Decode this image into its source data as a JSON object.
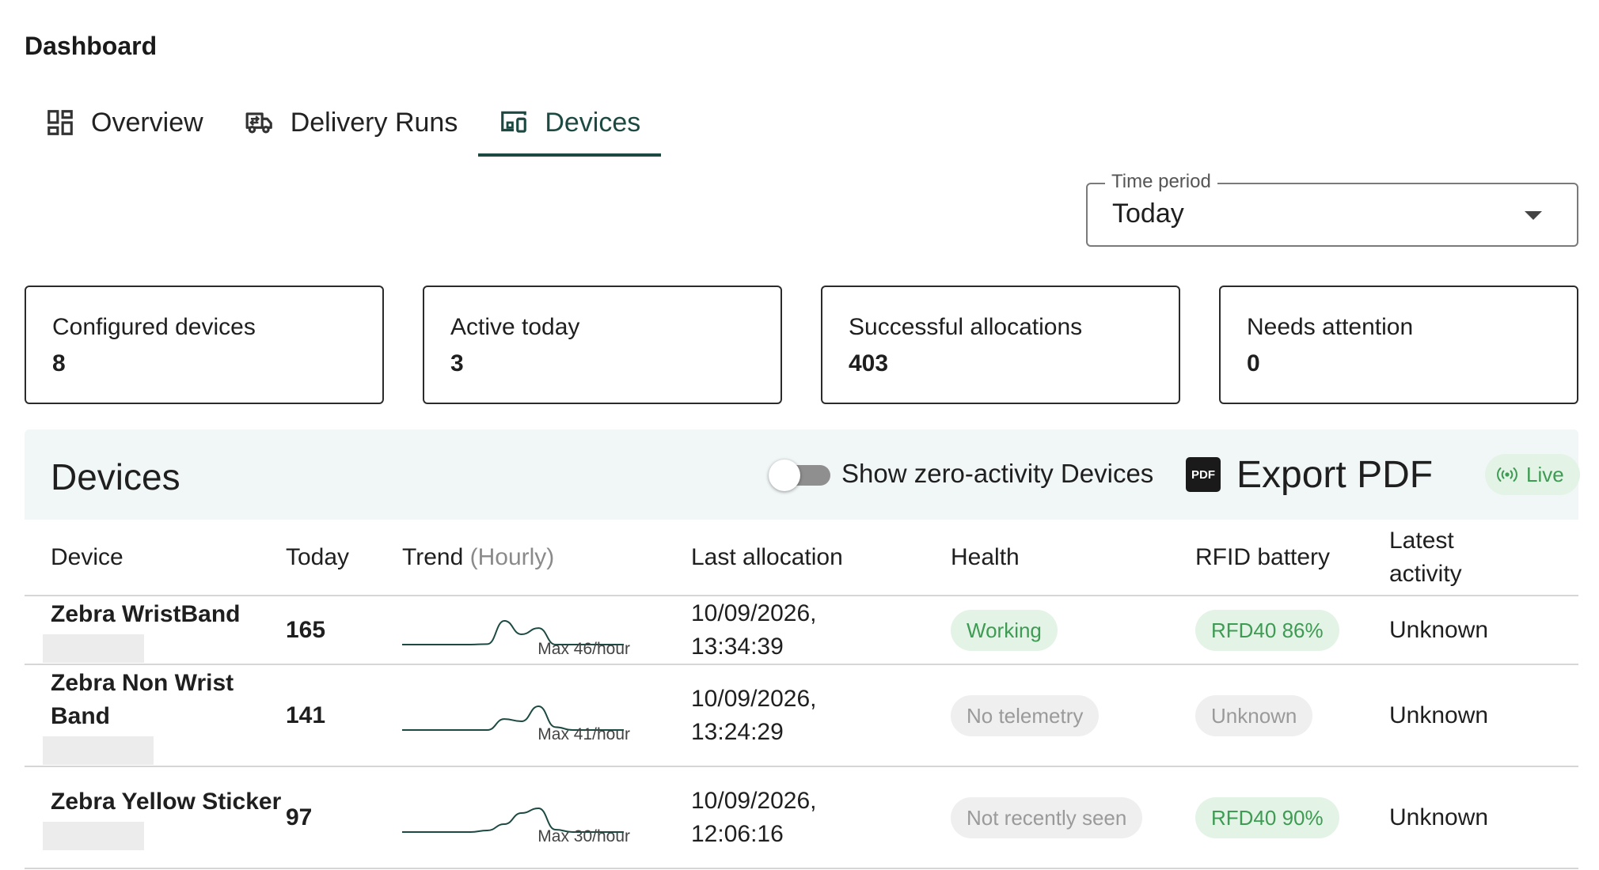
{
  "page": {
    "title": "Dashboard"
  },
  "tabs": [
    {
      "label": "Overview",
      "icon": "dashboard-icon",
      "active": false
    },
    {
      "label": "Delivery Runs",
      "icon": "truck-icon",
      "active": false
    },
    {
      "label": "Devices",
      "icon": "devices-icon",
      "active": true
    }
  ],
  "time_period": {
    "label": "Time period",
    "value": "Today"
  },
  "stats": [
    {
      "label": "Configured devices",
      "value": "8"
    },
    {
      "label": "Active today",
      "value": "3"
    },
    {
      "label": "Successful allocations",
      "value": "403"
    },
    {
      "label": "Needs attention",
      "value": "0"
    }
  ],
  "panel": {
    "title": "Devices",
    "toggle_label": "Show zero-activity Devices",
    "toggle_on": false,
    "export_label": "Export PDF",
    "pdf_icon_text": "PDF",
    "live_label": "Live"
  },
  "table": {
    "headers": {
      "device": "Device",
      "today": "Today",
      "trend": "Trend",
      "trend_suffix": "(Hourly)",
      "last_allocation": "Last allocation",
      "health": "Health",
      "rfid_battery": "RFID battery",
      "latest_activity_line1": "Latest",
      "latest_activity_line2": "activity"
    },
    "rows": [
      {
        "device": "Zebra WristBand",
        "today": "165",
        "trend_caption": "Max 46/hour",
        "trend": [
          0,
          0,
          0,
          0,
          0,
          1,
          46,
          20,
          32,
          0,
          0,
          0,
          0,
          0
        ],
        "last_date": "10/09/2026,",
        "last_time": "13:34:39",
        "health": "Working",
        "health_tone": "green",
        "battery": "RFD40 86%",
        "battery_tone": "green",
        "latest_activity": "Unknown"
      },
      {
        "device": "Zebra Non Wrist Band",
        "today": "141",
        "trend_caption": "Max 41/hour",
        "trend": [
          0,
          0,
          0,
          0,
          0,
          0,
          19,
          15,
          41,
          5,
          0,
          0,
          0,
          0
        ],
        "last_date": "10/09/2026,",
        "last_time": "13:24:29",
        "health": "No telemetry",
        "health_tone": "grey",
        "battery": "Unknown",
        "battery_tone": "grey",
        "latest_activity": "Unknown"
      },
      {
        "device": "Zebra Yellow Sticker",
        "today": "97",
        "trend_caption": "Max 30/hour",
        "trend": [
          0,
          0,
          0,
          0,
          0,
          2,
          10,
          24,
          30,
          3,
          0,
          0,
          0,
          0
        ],
        "last_date": "10/09/2026,",
        "last_time": "12:06:16",
        "health": "Not recently seen",
        "health_tone": "grey",
        "battery": "RFD40 90%",
        "battery_tone": "green",
        "latest_activity": "Unknown"
      }
    ]
  },
  "colors": {
    "accent": "#1c4a42",
    "sparkline": "#1c4a42",
    "status_green_bg": "#e3f3e6",
    "status_green_text": "#3e9b53",
    "status_grey_bg": "#efefef",
    "status_grey_text": "#9a9a9a",
    "panel_bg": "#f1f6f6"
  }
}
